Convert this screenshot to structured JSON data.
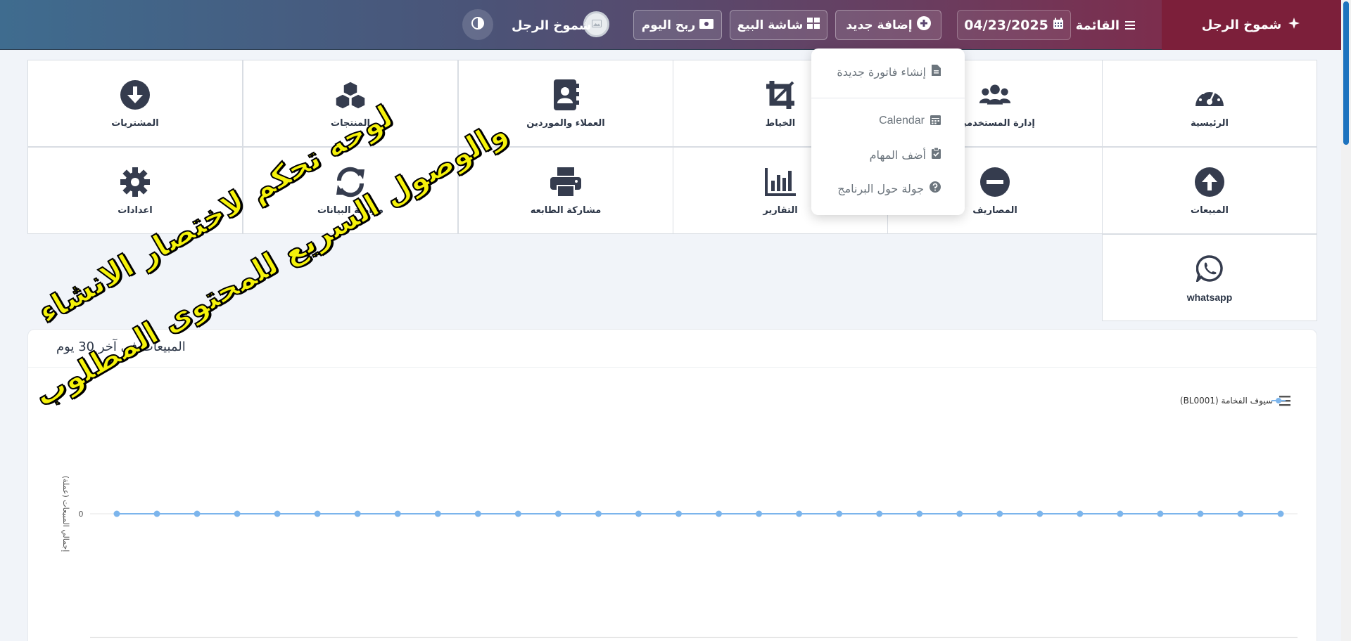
{
  "topbar": {
    "brand": "شموخ الرجل",
    "menu_label": "القائمة",
    "date_value": "04/23/2025",
    "add_new_label": "إضافة جديد",
    "pos_label": "شاشة البيع",
    "profit_label": "ربح اليوم",
    "user_name": "شموخ الرجل"
  },
  "dropdown": {
    "items": [
      {
        "label": "إنشاء فاتورة جديدة",
        "icon": "file-icon"
      },
      {
        "label": "Calendar",
        "icon": "calendar-icon"
      },
      {
        "label": "أضف المهام",
        "icon": "clipboard-check-icon"
      },
      {
        "label": "جولة حول البرنامج",
        "icon": "question-circle-icon"
      }
    ]
  },
  "tiles": {
    "home": {
      "label": "الرئيسية",
      "icon": "gauge-icon"
    },
    "users": {
      "label": "إدارة المستخدمين",
      "icon": "users-icon"
    },
    "tailor": {
      "label": "الخياط",
      "icon": "crop-icon"
    },
    "contacts": {
      "label": "العملاء والموردين",
      "icon": "address-book-icon"
    },
    "products": {
      "label": "المنتجات",
      "icon": "cubes-icon"
    },
    "purchases": {
      "label": "المشتريات",
      "icon": "arrow-circle-down-icon"
    },
    "sales": {
      "label": "المبيعات",
      "icon": "arrow-circle-up-icon"
    },
    "expenses": {
      "label": "المصاريف",
      "icon": "minus-circle-icon"
    },
    "reports": {
      "label": "التقارير",
      "icon": "chart-bar-icon"
    },
    "printer": {
      "label": "مشاركة الطابعه",
      "icon": "print-icon"
    },
    "sync": {
      "label": "مزامنة البيانات",
      "icon": "sync-icon"
    },
    "settings": {
      "label": "اعدادات",
      "icon": "gear-icon"
    },
    "whatsapp": {
      "label": "whatsapp",
      "icon": "whatsapp-icon"
    }
  },
  "annotation": {
    "line1": "لوحه تحكم لاختصار الانشاء",
    "line2": "والوصول السريع للمحتوى المطلوب"
  },
  "chart": {
    "title": "المبيعات في آخر 30 يوم"
  },
  "chart_data": {
    "type": "line",
    "title": "المبيعات في آخر 30 يوم",
    "ylabel": "إجمالي المبيعات (عملة)",
    "xlabel": "",
    "yticks": [
      "0"
    ],
    "series": [
      {
        "name": "سيوف الفخامة (BL0001)",
        "color": "#7cb5ec",
        "values": [
          0,
          0,
          0,
          0,
          0,
          0,
          0,
          0,
          0,
          0,
          0,
          0,
          0,
          0,
          0,
          0,
          0,
          0,
          0,
          0,
          0,
          0,
          0,
          0,
          0,
          0,
          0,
          0,
          0,
          0
        ]
      }
    ],
    "grid": true,
    "legend_position": "top-right"
  },
  "colors": {
    "accent": "#7c1f3a",
    "icon_dark": "#353c4e",
    "series": "#7cb5ec",
    "annotation": "#f5f20a"
  }
}
